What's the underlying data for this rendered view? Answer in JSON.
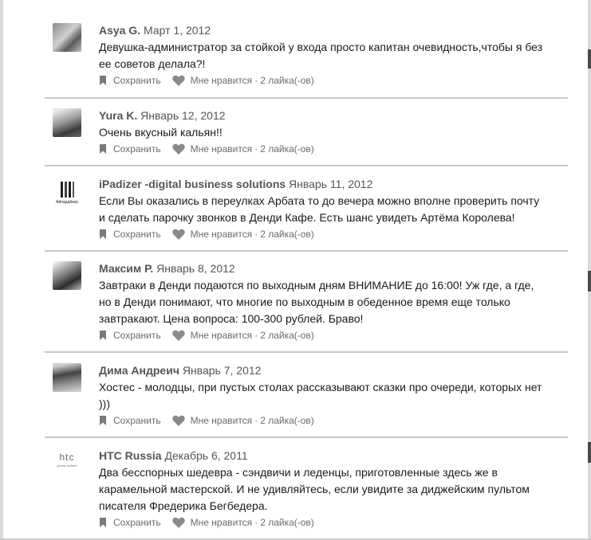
{
  "actions": {
    "save_label": "Сохранить",
    "like_label": "Мне нравится",
    "separator": "·"
  },
  "reviews": [
    {
      "name": "Asya G.",
      "date": "Март 1, 2012",
      "lines": [
        "Девушка-администратор за стойкой у входа просто капитан очевидность,чтобы я без",
        "ее советов делала?!"
      ],
      "likes": "2 лайка(-ов)",
      "avatar": "user-photo"
    },
    {
      "name": "Yura K.",
      "date": "Январь 12, 2012",
      "lines": [
        "Очень вкусный кальян!!"
      ],
      "likes": "2 лайка(-ов)",
      "avatar": "user-photo"
    },
    {
      "name": "iPadizer -digital business solutions",
      "date": "Январь 11, 2012",
      "lines": [
        "Если Вы оказались в переулках Арбата то до вечера можно вполне проверить почту",
        "и сделать парочку звонков в Денди Кафе. Есть шанс увидеть Артёма Королева!"
      ],
      "likes": "2 лайка(-ов)",
      "avatar": "company-logo",
      "logo_text": "Айпадайзер"
    },
    {
      "name": "Максим Р.",
      "date": "Январь 8, 2012",
      "lines": [
        "Завтраки в Денди подаются по выходным дням ВНИМАНИЕ до 16:00! Уж где, а где,",
        "но в Денди понимают, что многие по выходным в обеденное время еще только",
        "завтракают. Цена вопроса: 100-300 рублей. Браво!"
      ],
      "likes": "2 лайка(-ов)",
      "avatar": "user-photo"
    },
    {
      "name": "Дима Андреич",
      "date": "Январь 7, 2012",
      "lines": [
        "Хостес - молодцы, при пустых столах рассказывают сказки про очереди, которых нет",
        ")))"
      ],
      "likes": "2 лайка(-ов)",
      "avatar": "user-photo"
    },
    {
      "name": "HTC Russia",
      "date": "Декабрь 6, 2011",
      "lines": [
        "Два бесспорных шедевра - сэндвичи и леденцы, приготовленные здесь же в",
        "карамельной мастерской. И не удивляйтесь, если увидите за диджейским пультом",
        "писателя Фредерика Бегбедера."
      ],
      "likes": "2 лайка(-ов)",
      "avatar": "company-logo",
      "logo_text": "htc",
      "logo_tagline": "quietly brilliant"
    }
  ]
}
